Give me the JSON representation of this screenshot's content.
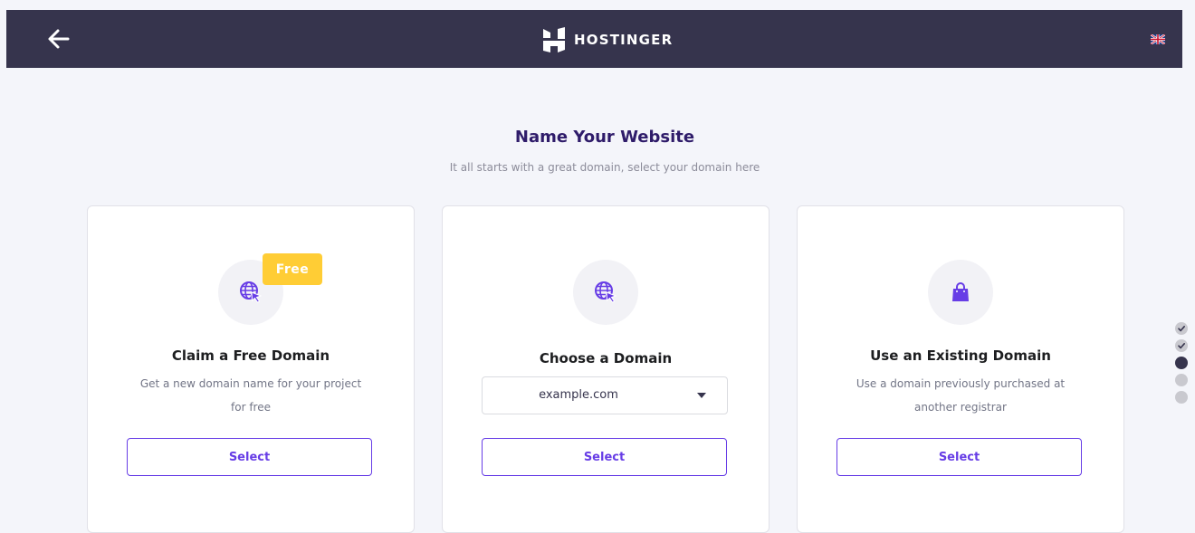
{
  "header": {
    "brand": "HOSTINGER",
    "back_icon": "arrow-left-icon",
    "language_icon": "uk-flag-icon"
  },
  "page": {
    "title": "Name Your Website",
    "subtitle": "It all starts with a great domain, select your domain here"
  },
  "cards": [
    {
      "icon": "globe-cursor-icon",
      "badge": "Free",
      "title": "Claim a Free Domain",
      "desc_line1": "Get a new domain name for your project",
      "desc_line2": "for free",
      "button": "Select"
    },
    {
      "icon": "globe-cursor-icon",
      "title": "Choose a Domain",
      "domain_value": "example.com",
      "button": "Select"
    },
    {
      "icon": "shopping-bag-icon",
      "title": "Use an Existing Domain",
      "desc_line1": "Use a domain previously purchased at",
      "desc_line2": "another registrar",
      "button": "Select"
    }
  ],
  "progress": {
    "total_steps": 5,
    "completed_steps": 2,
    "current_step": 3
  },
  "colors": {
    "header_bg": "#36344d",
    "page_bg": "#f4f5fa",
    "accent": "#673de6",
    "badge": "#ffcd35",
    "title_text": "#2f1c6a"
  }
}
